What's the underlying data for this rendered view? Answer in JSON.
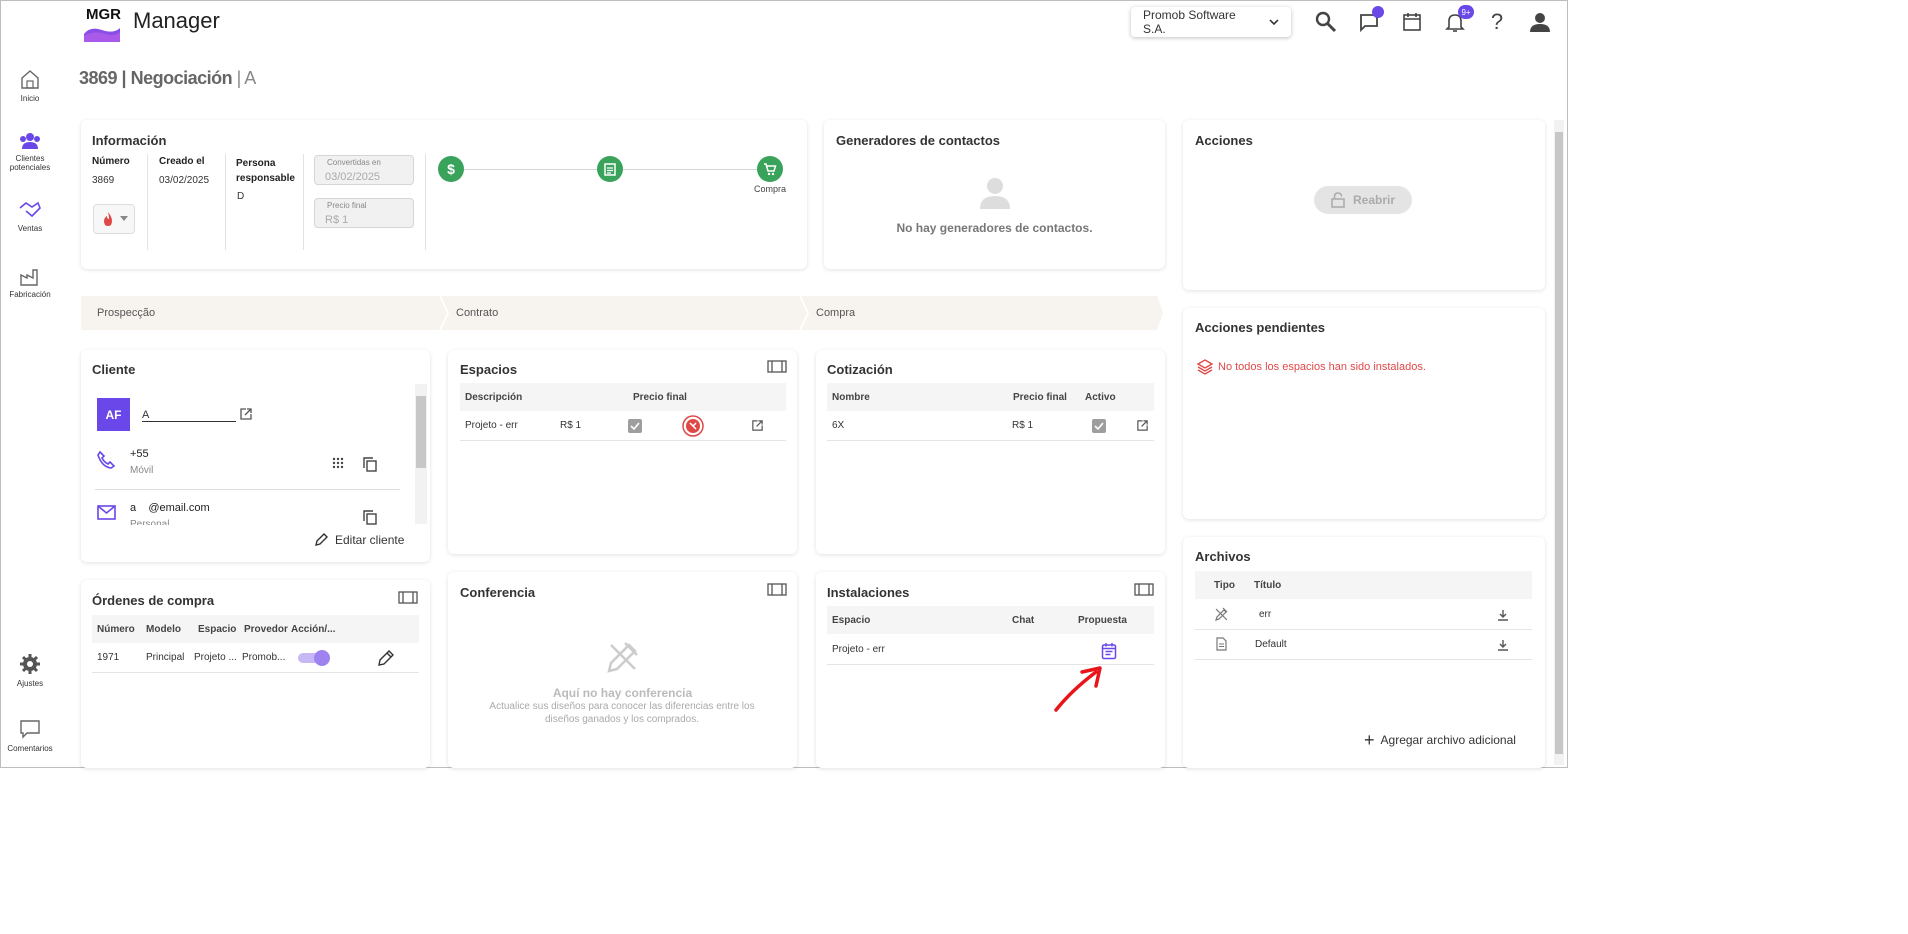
{
  "header": {
    "logo_text": "MGR",
    "app_name": "Manager",
    "company": "Promob Software S.A.",
    "notifications_badge": "9+"
  },
  "sidebar": {
    "items": [
      {
        "label": "Inicio",
        "icon": "home-icon"
      },
      {
        "label": "Clientes potenciales",
        "icon": "people-icon"
      },
      {
        "label": "Ventas",
        "icon": "handshake-icon"
      },
      {
        "label": "Fabricación",
        "icon": "factory-icon"
      }
    ],
    "bottom": [
      {
        "label": "Ajustes",
        "icon": "gear-icon"
      },
      {
        "label": "Comentarios",
        "icon": "comment-icon"
      }
    ]
  },
  "page": {
    "title_bold": "3869 | Negociación",
    "title_light": " | A"
  },
  "info": {
    "title": "Información",
    "numero_label": "Número",
    "numero": "3869",
    "creado_label": "Creado el",
    "creado": "03/02/2025",
    "persona_label": "Persona responsable",
    "persona": "D",
    "convertidas_label": "Convertidas en",
    "convertidas": "03/02/2025",
    "precio_label": "Precio final",
    "precio": "R$ 1",
    "step_label": "Compra"
  },
  "generadores": {
    "title": "Generadores de contactos",
    "empty": "No hay generadores de contactos."
  },
  "acciones": {
    "title": "Acciones",
    "reabrir": "Reabrir"
  },
  "pipeline": [
    "Prospecção",
    "Contrato",
    "Compra"
  ],
  "cliente": {
    "title": "Cliente",
    "initials": "AF",
    "name": "A",
    "phone": "+55",
    "phone_type": "Móvil",
    "email_user": "a",
    "email_domain": "@email.com",
    "email_type": "Personal",
    "edit": "Editar cliente"
  },
  "espacios": {
    "title": "Espacios",
    "headers": [
      "Descripción",
      "Precio final"
    ],
    "rows": [
      {
        "desc": "Projeto - err",
        "precio": "R$ 1"
      }
    ]
  },
  "cotizacion": {
    "title": "Cotización",
    "headers": [
      "Nombre",
      "Precio final",
      "Activo"
    ],
    "rows": [
      {
        "nombre": "6X",
        "precio": "R$ 1"
      }
    ]
  },
  "acciones_pendientes": {
    "title": "Acciones pendientes",
    "warning": "No todos los espacios han sido instalados."
  },
  "ordenes": {
    "title": "Órdenes de compra",
    "headers": [
      "Número",
      "Modelo",
      "Espacio",
      "Provedor",
      "Acción/..."
    ],
    "rows": [
      {
        "numero": "1971",
        "modelo": "Principal",
        "espacio": "Projeto ...",
        "provedor": "Promob..."
      }
    ]
  },
  "conferencia": {
    "title": "Conferencia",
    "empty_title": "Aquí no hay conferencia",
    "empty_desc": "Actualice sus diseños para conocer las diferencias entre los diseños ganados y los comprados."
  },
  "instalaciones": {
    "title": "Instalaciones",
    "headers": [
      "Espacio",
      "Chat",
      "Propuesta"
    ],
    "rows": [
      {
        "espacio": "Projeto - err"
      }
    ]
  },
  "archivos": {
    "title": "Archivos",
    "headers": [
      "Tipo",
      "Título"
    ],
    "rows": [
      {
        "titulo": "err",
        "icon": "design-file-icon"
      },
      {
        "titulo": "Default",
        "icon": "document-file-icon"
      }
    ],
    "add": "Agregar archivo adicional"
  },
  "colors": {
    "accent": "#6a47e8",
    "success": "#3aa35b",
    "danger": "#e04848"
  }
}
